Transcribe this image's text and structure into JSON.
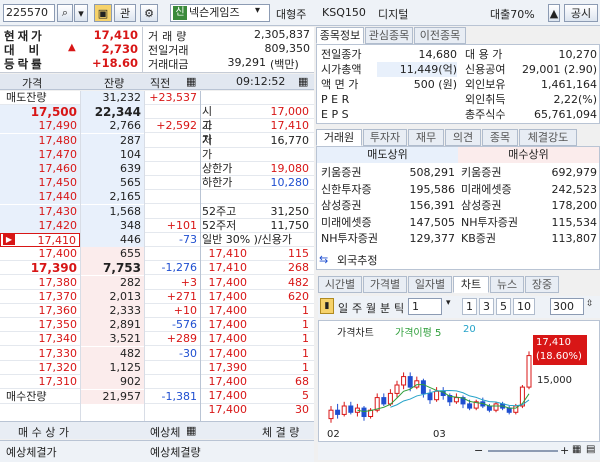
{
  "toolbar": {
    "code": "225570",
    "btn_search": "🔍",
    "btn_related": "관",
    "shin_badge": "신",
    "name": "넥슨게임즈",
    "fields": [
      "대형주",
      "KSQ150",
      "디지털"
    ],
    "loan": "대출70%",
    "btn_notice": "공시"
  },
  "summary": {
    "price_label": "현재가",
    "price": "17,410",
    "diff_label": "대비",
    "diff_arrow": "▲",
    "diff": "2,730",
    "rate_label": "등락률",
    "rate": "+18.60",
    "volume_label": "거래량",
    "volume": "2,305,837",
    "prev_label": "전일거래",
    "prev_volume": "809,350",
    "amount_label": "거래대금",
    "amount": "39,291",
    "amount_unit": "(백만)"
  },
  "orderbook": {
    "headers": [
      "가격",
      "잔량",
      "직전",
      "09:12:52"
    ],
    "total_ask_label": "매도잔량",
    "total_ask": "31,232",
    "total_ask_diff": "+23,537",
    "asks": [
      {
        "price": "17,500",
        "qty": "22,344",
        "diff": ""
      },
      {
        "price": "17,490",
        "qty": "2,766",
        "diff": "+2,592"
      },
      {
        "price": "17,480",
        "qty": "287",
        "diff": ""
      },
      {
        "price": "17,470",
        "qty": "104",
        "diff": ""
      },
      {
        "price": "17,460",
        "qty": "639",
        "diff": ""
      },
      {
        "price": "17,450",
        "qty": "565",
        "diff": ""
      },
      {
        "price": "17,440",
        "qty": "2,165",
        "diff": ""
      },
      {
        "price": "17,430",
        "qty": "1,568",
        "diff": ""
      },
      {
        "price": "17,420",
        "qty": "348",
        "diff": "+101"
      },
      {
        "price": "17,410",
        "qty": "446",
        "diff": "-73"
      }
    ],
    "bids": [
      {
        "price": "17,400",
        "qty": "655",
        "diff": ""
      },
      {
        "price": "17,390",
        "qty": "7,753",
        "diff": "-1,276"
      },
      {
        "price": "17,380",
        "qty": "282",
        "diff": "+3"
      },
      {
        "price": "17,370",
        "qty": "2,013",
        "diff": "+271"
      },
      {
        "price": "17,360",
        "qty": "2,333",
        "diff": "+10"
      },
      {
        "price": "17,350",
        "qty": "2,891",
        "diff": "-576"
      },
      {
        "price": "17,340",
        "qty": "3,521",
        "diff": "+289"
      },
      {
        "price": "17,330",
        "qty": "482",
        "diff": "-30"
      },
      {
        "price": "17,320",
        "qty": "1,125",
        "diff": ""
      },
      {
        "price": "17,310",
        "qty": "902",
        "diff": ""
      }
    ],
    "total_bid_label": "매수잔량",
    "total_bid": "21,957",
    "total_bid_diff": "-1,381",
    "right_info": [
      {
        "label": "시가",
        "value": "17,000"
      },
      {
        "label": "고가",
        "value": "17,410"
      },
      {
        "label": "저가",
        "value": "16,770"
      },
      {
        "label": "상한가",
        "value": "19,080"
      },
      {
        "label": "하한가",
        "value": "10,280"
      },
      {
        "label": "52주고",
        "value": "31,250"
      },
      {
        "label": "52주저",
        "value": "11,750"
      }
    ],
    "credit_label": "일반 30% )/신용가",
    "ticks": [
      {
        "price": "17,410",
        "qty": "115"
      },
      {
        "price": "17,410",
        "qty": "268"
      },
      {
        "price": "17,400",
        "qty": "482"
      },
      {
        "price": "17,400",
        "qty": "620"
      },
      {
        "price": "17,400",
        "qty": "1"
      },
      {
        "price": "17,400",
        "qty": "1"
      },
      {
        "price": "17,400",
        "qty": "1"
      },
      {
        "price": "17,400",
        "qty": "1"
      },
      {
        "price": "17,390",
        "qty": "1"
      },
      {
        "price": "17,400",
        "qty": "68"
      },
      {
        "price": "17,400",
        "qty": "5"
      },
      {
        "price": "17,400",
        "qty": "30"
      }
    ],
    "footer": [
      "매 수 상 가",
      "예상체",
      "체 결 량"
    ],
    "bottom": [
      "예상체결가",
      "예상체결량"
    ]
  },
  "info_panel": {
    "tabs": [
      "종목정보",
      "관심종목",
      "이전종목"
    ],
    "rows": [
      {
        "l": "전일종가",
        "v": "14,680",
        "l2": "대 용 가",
        "v2": "10,270"
      },
      {
        "l": "시가총액",
        "v": "11,449(억)",
        "l2": "신용공여",
        "v2": "29,001 (2.90)"
      },
      {
        "l": "액 면 가",
        "v": "500 (원)",
        "l2": "외인보유",
        "v2": "1,461,164"
      },
      {
        "l": "P E R",
        "v": "",
        "l2": "외인취득",
        "v2": "2,22(%)"
      },
      {
        "l": "E P S",
        "v": "",
        "l2": "총주식수",
        "v2": "65,761,094"
      }
    ]
  },
  "broker_panel": {
    "tabs": [
      "거래원",
      "투자자",
      "재무",
      "의견",
      "종목",
      "체결강도"
    ],
    "sell_header": "매도상위",
    "buy_header": "매수상위",
    "rows": [
      {
        "s": "키움증권",
        "sv": "508,291",
        "b": "키움증권",
        "bv": "692,979"
      },
      {
        "s": "신한투자증",
        "sv": "195,586",
        "b": "미래에셋증",
        "bv": "242,523"
      },
      {
        "s": "삼성증권",
        "sv": "156,391",
        "b": "삼성증권",
        "bv": "178,200"
      },
      {
        "s": "미래에셋증",
        "sv": "147,505",
        "b": "NH투자증권",
        "bv": "115,534"
      },
      {
        "s": "NH투자증권",
        "sv": "129,377",
        "b": "KB증권",
        "bv": "113,807"
      }
    ],
    "foreign_label": "외국추정"
  },
  "chart_panel": {
    "tabs": [
      "시간별",
      "가격별",
      "일자별",
      "차트",
      "뉴스",
      "장중"
    ],
    "period_btns": [
      "일",
      "주",
      "월",
      "분",
      "틱"
    ],
    "period_value": "1",
    "num_btns": [
      "1",
      "3",
      "5",
      "10"
    ],
    "count": "300",
    "legend_price": "가격차트",
    "legend_ma": "가격이평 5",
    "legend_ma2": "20",
    "price_badge": "17,410",
    "price_badge_rate": "(18.60%)",
    "axis_label": "15,000",
    "x_labels": [
      "02",
      "03"
    ]
  },
  "colors": {
    "up": "#d81616",
    "down": "#1f4fd0",
    "ma5": "#2e9e3a",
    "ma20": "#26a3c9"
  }
}
